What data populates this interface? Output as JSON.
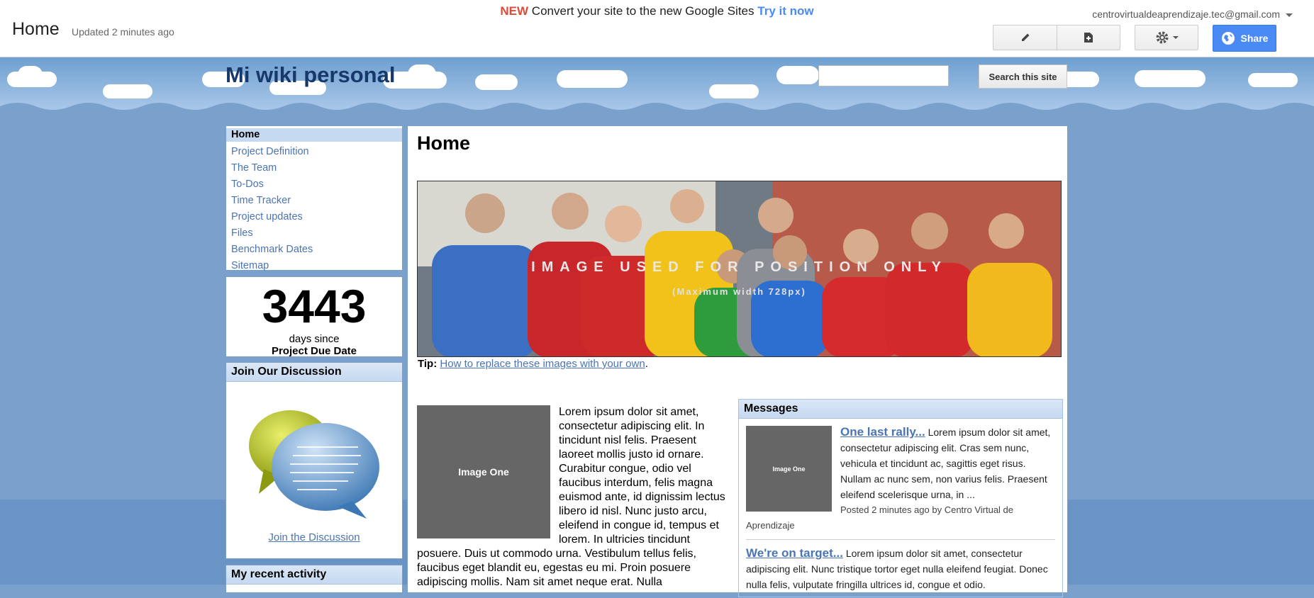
{
  "topbar": {
    "page_title": "Home",
    "updated": "Updated 2 minutes ago",
    "promo_new": "NEW",
    "promo_text": "Convert your site to the new Google Sites",
    "promo_link": "Try it now",
    "account": "centrovirtualdeaprendizaje.tec@gmail.com",
    "share_label": "Share",
    "icons": [
      "pencil-icon",
      "new-page-icon",
      "gear-icon",
      "globe-icon"
    ]
  },
  "header": {
    "site_title": "Mi wiki personal",
    "search_placeholder": "",
    "search_button": "Search this site"
  },
  "sidebar": {
    "nav": [
      {
        "label": "Home",
        "active": true
      },
      {
        "label": "Project Definition"
      },
      {
        "label": "The Team"
      },
      {
        "label": "To-Dos"
      },
      {
        "label": "Time Tracker"
      },
      {
        "label": "Project updates"
      },
      {
        "label": "Files"
      },
      {
        "label": "Benchmark Dates"
      },
      {
        "label": "Sitemap"
      }
    ],
    "counter": {
      "number": "3443",
      "days_text": "days since",
      "label": "Project Due Date"
    },
    "discussion": {
      "title": "Join Our Discussion",
      "link": "Join the Discussion"
    },
    "activity": {
      "title": "My recent activity"
    }
  },
  "main": {
    "title": "Home",
    "hero_caption": "IMAGE USED FOR POSITION ONLY",
    "hero_sub": "(Maximum width 728px)",
    "tip_label": "Tip:",
    "tip_link": "How to replace these images with your own",
    "tip_end": ".",
    "image_one_label": "Image One",
    "lorem": "Lorem ipsum dolor sit amet, consectetur adipiscing elit. In tincidunt nisl felis. Praesent laoreet mollis justo id ornare. Curabitur congue, odio vel faucibus interdum, felis magna euismod ante, id dignissim lectus libero id nisl. Nunc justo arcu, eleifend in congue id, tempus et lorem. In ultricies tincidunt posuere. Duis ut commodo urna. Vestibulum tellus felis, faucibus eget blandit eu, egestas eu mi. Proin posuere adipiscing mollis. Nam sit amet neque erat. Nulla"
  },
  "messages": {
    "title": "Messages",
    "items": [
      {
        "title": "One last rally...",
        "image_label": "Image One",
        "body": "Lorem ipsum dolor sit amet, consectetur adipiscing elit. Cras sem nunc, vehicula et tincidunt ac, sagittis eget risus. Nullam ac nunc sem, non varius felis. Praesent eleifend scelerisque urna, in ...",
        "meta": "Posted 2 minutes ago by Centro Virtual de Aprendizaje"
      },
      {
        "title": "We're on target...",
        "body": "Lorem ipsum dolor sit amet, consectetur adipiscing elit. Nunc tristique tortor eget nulla eleifend feugiat. Donec nulla felis, vulputate fringilla ultrices id, congue et odio."
      }
    ]
  }
}
